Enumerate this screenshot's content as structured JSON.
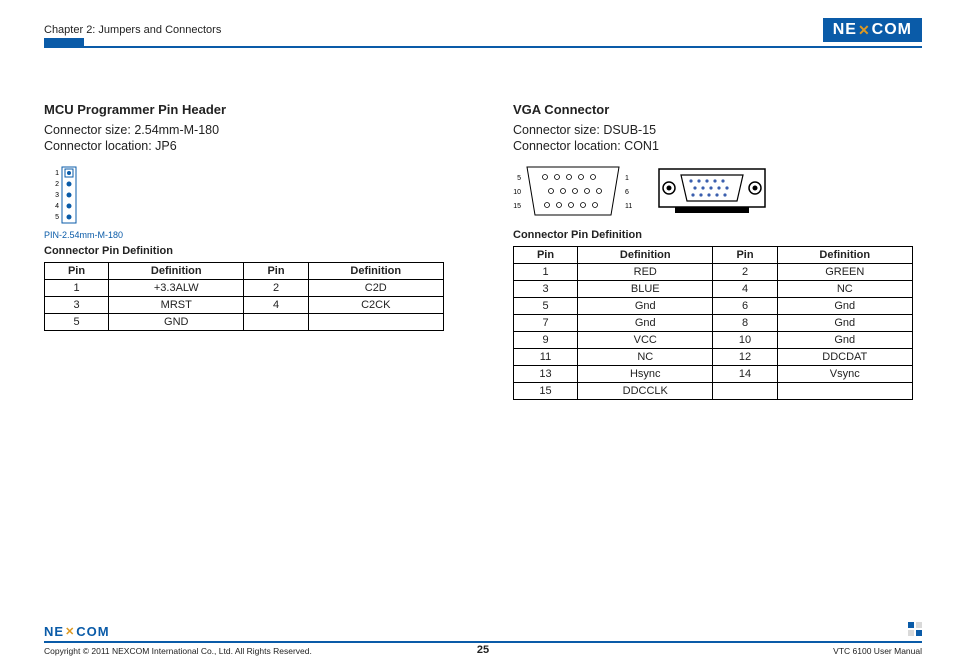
{
  "header": {
    "chapter": "Chapter 2: Jumpers and Connectors",
    "logo_left": "NE",
    "logo_x": "✕",
    "logo_right": "COM"
  },
  "left": {
    "title": "MCU Programmer Pin Header",
    "size_label": "Connector size: 2.54mm-M-180",
    "loc_label": "Connector location: JP6",
    "pin_caption": "PIN-2.54mm-M-180",
    "subhead": "Connector Pin Definition",
    "th_pin": "Pin",
    "th_def": "Definition",
    "rows": [
      {
        "p1": "1",
        "d1": "+3.3ALW",
        "p2": "2",
        "d2": "C2D"
      },
      {
        "p1": "3",
        "d1": "MRST",
        "p2": "4",
        "d2": "C2CK"
      },
      {
        "p1": "5",
        "d1": "GND",
        "p2": "",
        "d2": ""
      }
    ]
  },
  "right": {
    "title": "VGA Connector",
    "size_label": "Connector size: DSUB-15",
    "loc_label": "Connector location: CON1",
    "subhead": "Connector Pin Definition",
    "th_pin": "Pin",
    "th_def": "Definition",
    "rows": [
      {
        "p1": "1",
        "d1": "RED",
        "p2": "2",
        "d2": "GREEN"
      },
      {
        "p1": "3",
        "d1": "BLUE",
        "p2": "4",
        "d2": "NC"
      },
      {
        "p1": "5",
        "d1": "Gnd",
        "p2": "6",
        "d2": "Gnd"
      },
      {
        "p1": "7",
        "d1": "Gnd",
        "p2": "8",
        "d2": "Gnd"
      },
      {
        "p1": "9",
        "d1": "VCC",
        "p2": "10",
        "d2": "Gnd"
      },
      {
        "p1": "11",
        "d1": "NC",
        "p2": "12",
        "d2": "DDCDAT"
      },
      {
        "p1": "13",
        "d1": "Hsync",
        "p2": "14",
        "d2": "Vsync"
      },
      {
        "p1": "15",
        "d1": "DDCCLK",
        "p2": "",
        "d2": ""
      }
    ],
    "diag_labels": {
      "l1": "5",
      "r1": "1",
      "l2": "10",
      "r2": "6",
      "l3": "15",
      "r3": "11"
    }
  },
  "footer": {
    "copyright": "Copyright © 2011 NEXCOM International Co., Ltd. All Rights Reserved.",
    "page": "25",
    "manual": "VTC 6100 User Manual"
  }
}
